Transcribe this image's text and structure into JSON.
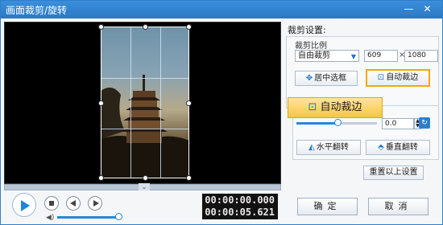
{
  "window": {
    "title": "画面裁剪/旋转",
    "minimize_glyph": "—",
    "close_glyph": "✕"
  },
  "player": {
    "current_time": "00:00:00.000",
    "total_time": "00:00:05.621",
    "volume_level": 0.95
  },
  "crop": {
    "section_title": "裁剪设置:",
    "ratio_label": "裁剪比例",
    "ratio_value": "自由裁剪",
    "width": "609",
    "height": "1080",
    "times_sign": "×",
    "center_button": "居中选框",
    "auto_button": "自动裁边"
  },
  "callout": {
    "label": "自动裁边"
  },
  "rotate": {
    "angle": "0.0",
    "slider_level": 0.5,
    "flip_h": "水平翻转",
    "flip_v": "垂直翻转"
  },
  "reset_button": "重置以上设置",
  "ok_button": "确定",
  "cancel_button": "取消",
  "icons": {
    "center": "center-frame-icon",
    "auto": "auto-crop-icon",
    "flip_h": "flip-horizontal-icon",
    "flip_v": "flip-vertical-icon",
    "rotate": "rotate-icon",
    "volume": "volume-icon"
  },
  "colors": {
    "accent": "#2a86d8",
    "highlight": "#f2a900",
    "titlebar": "#3b8fdc"
  }
}
